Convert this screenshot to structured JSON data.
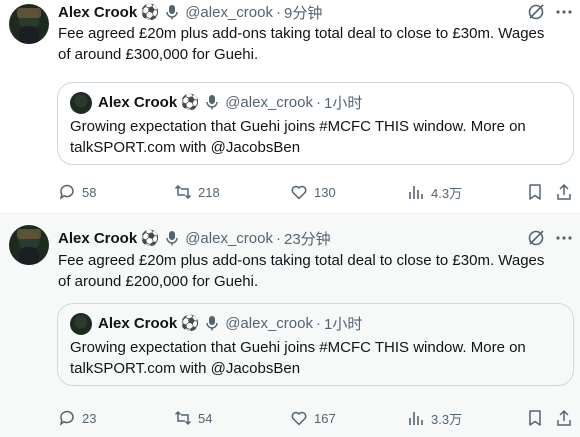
{
  "tweets": [
    {
      "author": {
        "name": "Alex Crook",
        "handle": "@alex_crook",
        "badges": [
          "soccer-ball-icon",
          "microphone-icon"
        ]
      },
      "separator": "·",
      "time": "9分钟",
      "text": "Fee agreed £20m plus add-ons taking total deal to close to £30m. Wages of around £300,000 for Guehi.",
      "quote": {
        "author": {
          "name": "Alex Crook",
          "handle": "@alex_crook"
        },
        "separator": "·",
        "time": "1小时",
        "text": "Growing expectation that Guehi joins #MCFC THIS window. More on talkSPORT.com with @JacobsBen"
      },
      "stats": {
        "replies": "58",
        "retweets": "218",
        "likes": "130",
        "views": "4.3万"
      }
    },
    {
      "author": {
        "name": "Alex Crook",
        "handle": "@alex_crook",
        "badges": [
          "soccer-ball-icon",
          "microphone-icon"
        ]
      },
      "separator": "·",
      "time": "23分钟",
      "text": "Fee agreed £20m plus add-ons taking total deal to close to £30m. Wages of around £200,000 for Guehi.",
      "quote": {
        "author": {
          "name": "Alex Crook",
          "handle": "@alex_crook"
        },
        "separator": "·",
        "time": "1小时",
        "text": "Growing expectation that Guehi joins #MCFC THIS window. More on talkSPORT.com with @JacobsBen"
      },
      "stats": {
        "replies": "23",
        "retweets": "54",
        "likes": "167",
        "views": "3.3万"
      }
    }
  ],
  "colors": {
    "text": "#0f1419",
    "secondary": "#536471",
    "border": "#cfd9de",
    "hover_bg": "#f7f9f9"
  }
}
